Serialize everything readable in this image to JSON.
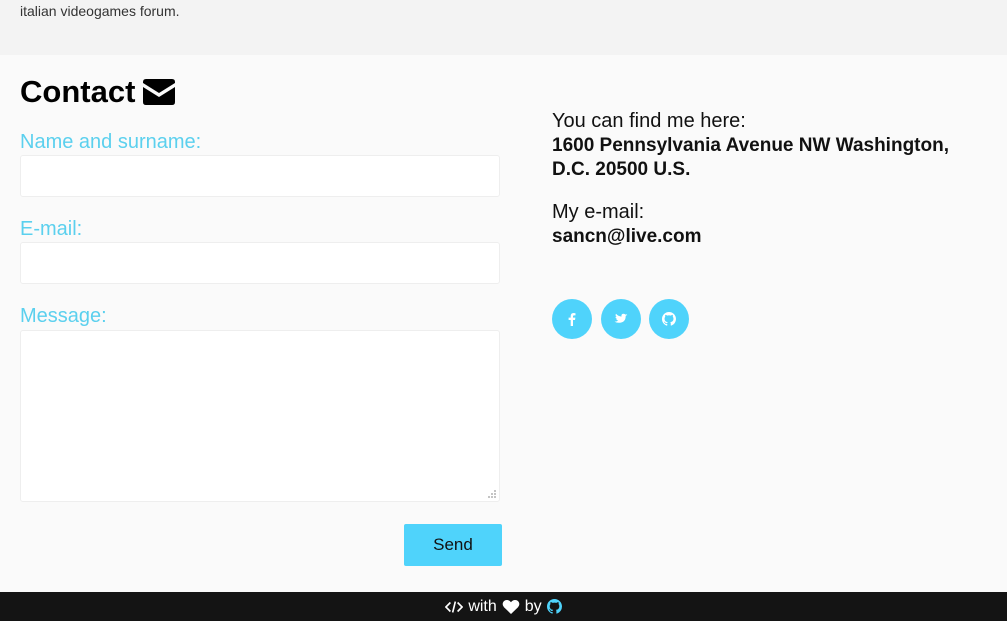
{
  "header": {
    "blurb": "italian videogames forum."
  },
  "contact": {
    "title": "Contact",
    "title_icon": "envelope-icon"
  },
  "form": {
    "name_label": "Name and surname:",
    "name_value": "",
    "email_label": "E-mail:",
    "email_value": "",
    "message_label": "Message:",
    "message_value": "",
    "send_label": "Send"
  },
  "info": {
    "intro": "You can find me here:",
    "address": "1600 Pennsylvania Avenue NW Washington, D.C. 20500 U.S.",
    "email_label": "My e-mail:",
    "email": "sancn@live.com"
  },
  "social": [
    {
      "name": "facebook",
      "icon": "facebook-icon"
    },
    {
      "name": "twitter",
      "icon": "twitter-icon"
    },
    {
      "name": "github",
      "icon": "github-icon"
    }
  ],
  "footer": {
    "with": "with",
    "by": "by",
    "code_icon": "code-icon",
    "heart_icon": "heart-icon",
    "github_icon": "github-icon"
  },
  "colors": {
    "accent": "#4fd3fb",
    "label": "#5bd0ee",
    "footer_bg": "#141414",
    "page_bg": "#fafafa"
  }
}
